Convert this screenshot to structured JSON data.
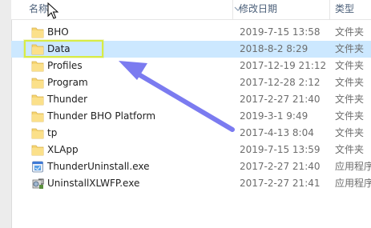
{
  "header": {
    "name_label": "名称",
    "date_label": "修改日期",
    "type_label": "类型"
  },
  "files": [
    {
      "name": "BHO",
      "date": "2019-7-15 13:58",
      "type": "文件夹",
      "icon": "folder-icon"
    },
    {
      "name": "Data",
      "date": "2018-8-2 8:29",
      "type": "文件夹",
      "icon": "folder-icon",
      "selected": true
    },
    {
      "name": "Profiles",
      "date": "2017-12-19 21:12",
      "type": "文件夹",
      "icon": "folder-icon"
    },
    {
      "name": "Program",
      "date": "2017-12-28 2:12",
      "type": "文件夹",
      "icon": "folder-icon"
    },
    {
      "name": "Thunder",
      "date": "2017-2-27 21:40",
      "type": "文件夹",
      "icon": "folder-icon"
    },
    {
      "name": "Thunder BHO Platform",
      "date": "2019-3-1 9:49",
      "type": "文件夹",
      "icon": "folder-icon"
    },
    {
      "name": "tp",
      "date": "2017-4-13 8:04",
      "type": "文件夹",
      "icon": "folder-icon"
    },
    {
      "name": "XLApp",
      "date": "2019-7-15 13:59",
      "type": "文件夹",
      "icon": "folder-icon"
    },
    {
      "name": "ThunderUninstall.exe",
      "date": "2017-2-27 21:40",
      "type": "应用程序",
      "icon": "uninstaller-app-icon"
    },
    {
      "name": "UninstallXLWFP.exe",
      "date": "2017-2-27 21:41",
      "type": "应用程序",
      "icon": "installer-app-icon"
    }
  ],
  "colors": {
    "selection": "#cce8ff",
    "highlight_box": "#d8ec44",
    "arrow": "#7b7bf0",
    "folder": "#f6d573"
  }
}
